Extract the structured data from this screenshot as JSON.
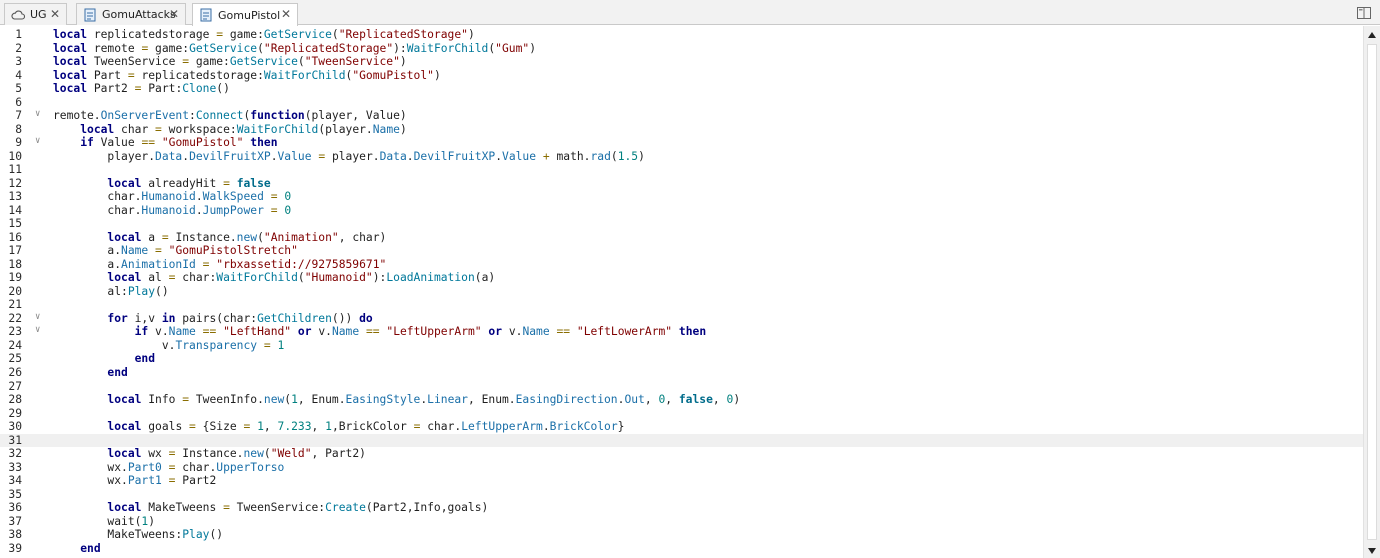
{
  "tabs": [
    {
      "label": "UG",
      "icon": "cloud-icon",
      "close": "✕"
    },
    {
      "label": "GomuAttacks",
      "icon": "script-icon",
      "close": "✕"
    },
    {
      "label": "GomuPistol",
      "icon": "script-icon",
      "close": "✕"
    }
  ],
  "active_tab": 2,
  "current_line": 31,
  "code_lines": [
    {
      "n": "1",
      "fold": "",
      "src": "local replicatedstorage = game:GetService(\"ReplicatedStorage\")"
    },
    {
      "n": "2",
      "fold": "",
      "src": "local remote = game:GetService(\"ReplicatedStorage\"):WaitForChild(\"Gum\")"
    },
    {
      "n": "3",
      "fold": "",
      "src": "local TweenService = game:GetService(\"TweenService\")"
    },
    {
      "n": "4",
      "fold": "",
      "src": "local Part = replicatedstorage:WaitForChild(\"GomuPistol\")"
    },
    {
      "n": "5",
      "fold": "",
      "src": "local Part2 = Part:Clone()"
    },
    {
      "n": "6",
      "fold": "",
      "src": ""
    },
    {
      "n": "7",
      "fold": "v",
      "src": "remote.OnServerEvent:Connect(function(player, Value)"
    },
    {
      "n": "8",
      "fold": "",
      "src": "    local char = workspace:WaitForChild(player.Name)"
    },
    {
      "n": "9",
      "fold": "v",
      "src": "    if Value == \"GomuPistol\" then"
    },
    {
      "n": "10",
      "fold": "",
      "src": "        player.Data.DevilFruitXP.Value = player.Data.DevilFruitXP.Value + math.rad(1.5)"
    },
    {
      "n": "11",
      "fold": "",
      "src": ""
    },
    {
      "n": "12",
      "fold": "",
      "src": "        local alreadyHit = false"
    },
    {
      "n": "13",
      "fold": "",
      "src": "        char.Humanoid.WalkSpeed = 0"
    },
    {
      "n": "14",
      "fold": "",
      "src": "        char.Humanoid.JumpPower = 0"
    },
    {
      "n": "15",
      "fold": "",
      "src": ""
    },
    {
      "n": "16",
      "fold": "",
      "src": "        local a = Instance.new(\"Animation\", char)"
    },
    {
      "n": "17",
      "fold": "",
      "src": "        a.Name = \"GomuPistolStretch\""
    },
    {
      "n": "18",
      "fold": "",
      "src": "        a.AnimationId = \"rbxassetid://9275859671\""
    },
    {
      "n": "19",
      "fold": "",
      "src": "        local al = char:WaitForChild(\"Humanoid\"):LoadAnimation(a)"
    },
    {
      "n": "20",
      "fold": "",
      "src": "        al:Play()"
    },
    {
      "n": "21",
      "fold": "",
      "src": ""
    },
    {
      "n": "22",
      "fold": "v",
      "src": "        for i,v in pairs(char:GetChildren()) do"
    },
    {
      "n": "23",
      "fold": "v",
      "src": "            if v.Name == \"LeftHand\" or v.Name == \"LeftUpperArm\" or v.Name == \"LeftLowerArm\" then"
    },
    {
      "n": "24",
      "fold": "",
      "src": "                v.Transparency = 1"
    },
    {
      "n": "25",
      "fold": "",
      "src": "            end"
    },
    {
      "n": "26",
      "fold": "",
      "src": "        end"
    },
    {
      "n": "27",
      "fold": "",
      "src": ""
    },
    {
      "n": "28",
      "fold": "",
      "src": "        local Info = TweenInfo.new(1, Enum.EasingStyle.Linear, Enum.EasingDirection.Out, 0, false, 0)"
    },
    {
      "n": "29",
      "fold": "",
      "src": ""
    },
    {
      "n": "30",
      "fold": "",
      "src": "        local goals = {Size = 1, 7.233, 1,BrickColor = char.LeftUpperArm.BrickColor}"
    },
    {
      "n": "31",
      "fold": "",
      "src": ""
    },
    {
      "n": "32",
      "fold": "",
      "src": "        local wx = Instance.new(\"Weld\", Part2)"
    },
    {
      "n": "33",
      "fold": "",
      "src": "        wx.Part0 = char.UpperTorso"
    },
    {
      "n": "34",
      "fold": "",
      "src": "        wx.Part1 = Part2"
    },
    {
      "n": "35",
      "fold": "",
      "src": ""
    },
    {
      "n": "36",
      "fold": "",
      "src": "        local MakeTweens = TweenService:Create(Part2,Info,goals)"
    },
    {
      "n": "37",
      "fold": "",
      "src": "        wait(1)"
    },
    {
      "n": "38",
      "fold": "",
      "src": "        MakeTweens:Play()"
    },
    {
      "n": "39",
      "fold": "",
      "src": "    end"
    }
  ],
  "colors": {
    "keyword": "#00007f",
    "builtin": "#006c8b",
    "string": "#7f0000",
    "number": "#00807f",
    "operator": "#8a6d00",
    "method": "#00789a",
    "current_line_bg": "#f0f0f0"
  }
}
